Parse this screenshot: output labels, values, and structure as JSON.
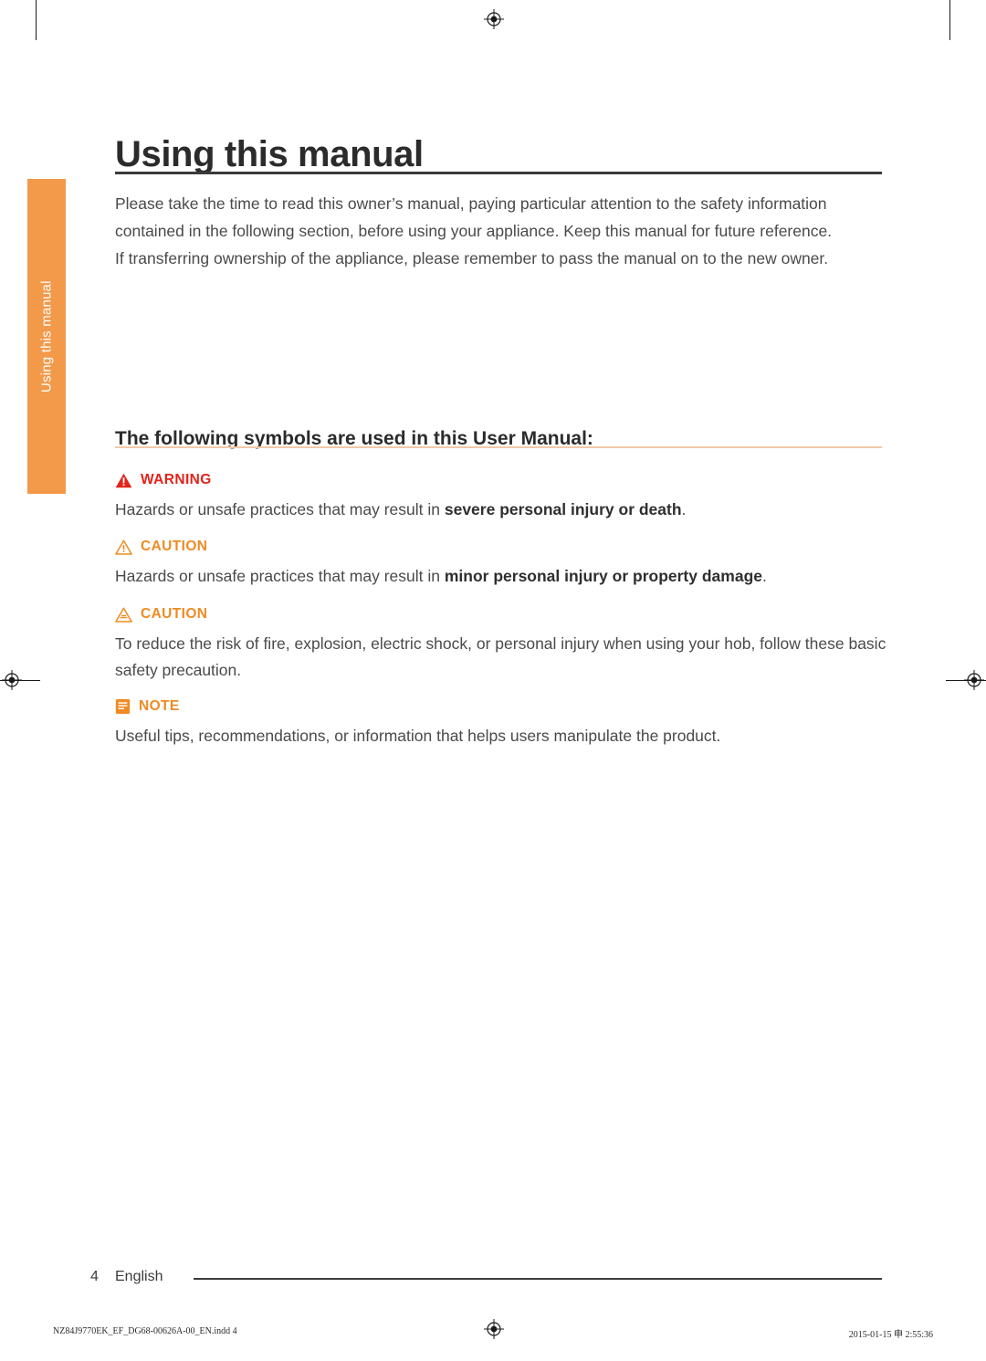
{
  "side_tab": {
    "label": "Using this manual",
    "color": "#f2994a"
  },
  "header": {
    "title": "Using this manual"
  },
  "intro": {
    "paragraph1": "Please take the time to read this owner’s manual, paying particular attention to the safety information contained in the following section, before using your appliance. Keep this manual for future reference.",
    "paragraph2": "If transferring ownership of the appliance, please remember to pass the manual on to the new owner."
  },
  "section": {
    "heading": "The following symbols are used in this User Manual:"
  },
  "symbols": [
    {
      "icon": "warning-triangle-icon",
      "label": "WARNING",
      "color": "#e2231a",
      "text_pre": "Hazards or unsafe practices that may result in ",
      "text_bold": "severe personal injury or death",
      "text_post": "."
    },
    {
      "icon": "caution-triangle-icon",
      "label": "CAUTION",
      "color": "#ef8b24",
      "text_pre": "Hazards or unsafe practices that may result in ",
      "text_bold": "minor personal injury or property damage",
      "text_post": "."
    },
    {
      "icon": "caution-triangle-icon",
      "label": "CAUTION",
      "color": "#ef8b24",
      "text_pre": "To reduce the risk of fire, explosion, electric shock, or personal injury when using your hob, follow these basic safety precaution.",
      "text_bold": "",
      "text_post": ""
    },
    {
      "icon": "note-document-icon",
      "label": "NOTE",
      "color": "#ef8b24",
      "text_pre": "Useful tips, recommendations, or information that helps users manipulate the product.",
      "text_bold": "",
      "text_post": ""
    }
  ],
  "footer": {
    "page_number": "4",
    "language": "English",
    "file_meta": "NZ84J9770EK_EF_DG68-00626A-00_EN.indd   4",
    "date_meta": "2015-01-15   申 2:55:36"
  }
}
